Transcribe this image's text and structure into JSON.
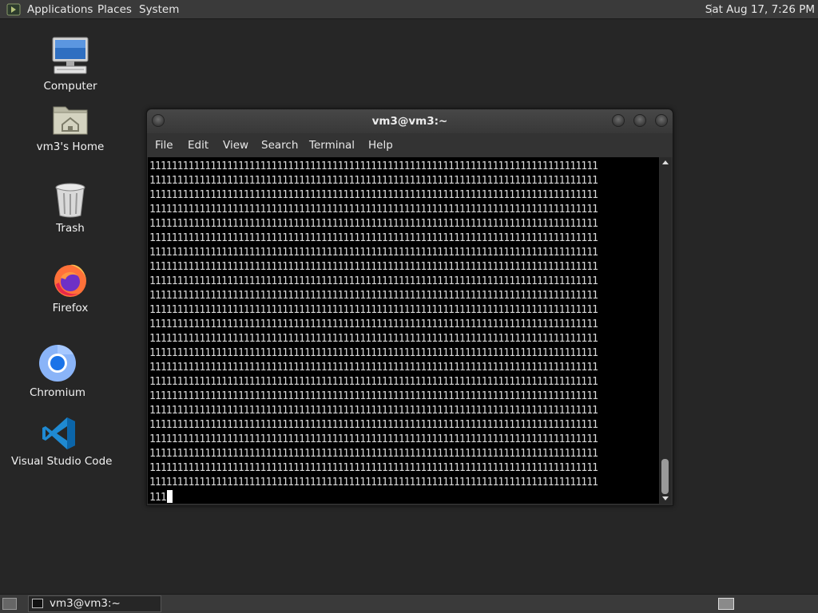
{
  "top_panel": {
    "menus": [
      "Applications",
      "Places",
      "System"
    ],
    "clock": "Sat Aug 17,  7:26 PM"
  },
  "desktop_icons": [
    {
      "label": "Computer",
      "icon": "computer-icon"
    },
    {
      "label": "vm3's Home",
      "icon": "home-folder-icon"
    },
    {
      "label": "Trash",
      "icon": "trash-icon"
    },
    {
      "label": "Firefox",
      "icon": "firefox-icon"
    },
    {
      "label": "Chromium",
      "icon": "chromium-icon"
    },
    {
      "label": "Visual Studio Code",
      "icon": "vscode-icon"
    }
  ],
  "terminal": {
    "title": "vm3@vm3:~",
    "menu": [
      "File",
      "Edit",
      "View",
      "Search",
      "Terminal",
      "Help"
    ],
    "lines": [
      "111111111111111111111111111111111111111111111111111111111111111111111111111111111",
      "111111111111111111111111111111111111111111111111111111111111111111111111111111111",
      "111111111111111111111111111111111111111111111111111111111111111111111111111111111",
      "111111111111111111111111111111111111111111111111111111111111111111111111111111111",
      "111111111111111111111111111111111111111111111111111111111111111111111111111111111",
      "111111111111111111111111111111111111111111111111111111111111111111111111111111111",
      "111111111111111111111111111111111111111111111111111111111111111111111111111111111",
      "111111111111111111111111111111111111111111111111111111111111111111111111111111111",
      "111111111111111111111111111111111111111111111111111111111111111111111111111111111",
      "111111111111111111111111111111111111111111111111111111111111111111111111111111111",
      "111111111111111111111111111111111111111111111111111111111111111111111111111111111",
      "111111111111111111111111111111111111111111111111111111111111111111111111111111111",
      "111111111111111111111111111111111111111111111111111111111111111111111111111111111",
      "111111111111111111111111111111111111111111111111111111111111111111111111111111111",
      "111111111111111111111111111111111111111111111111111111111111111111111111111111111",
      "111111111111111111111111111111111111111111111111111111111111111111111111111111111",
      "111111111111111111111111111111111111111111111111111111111111111111111111111111111",
      "111111111111111111111111111111111111111111111111111111111111111111111111111111111",
      "111111111111111111111111111111111111111111111111111111111111111111111111111111111",
      "111111111111111111111111111111111111111111111111111111111111111111111111111111111",
      "111111111111111111111111111111111111111111111111111111111111111111111111111111111",
      "111111111111111111111111111111111111111111111111111111111111111111111111111111111",
      "111111111111111111111111111111111111111111111111111111111111111111111111111111111",
      "111"
    ]
  },
  "taskbar": {
    "tasks": [
      "vm3@vm3:~"
    ]
  }
}
